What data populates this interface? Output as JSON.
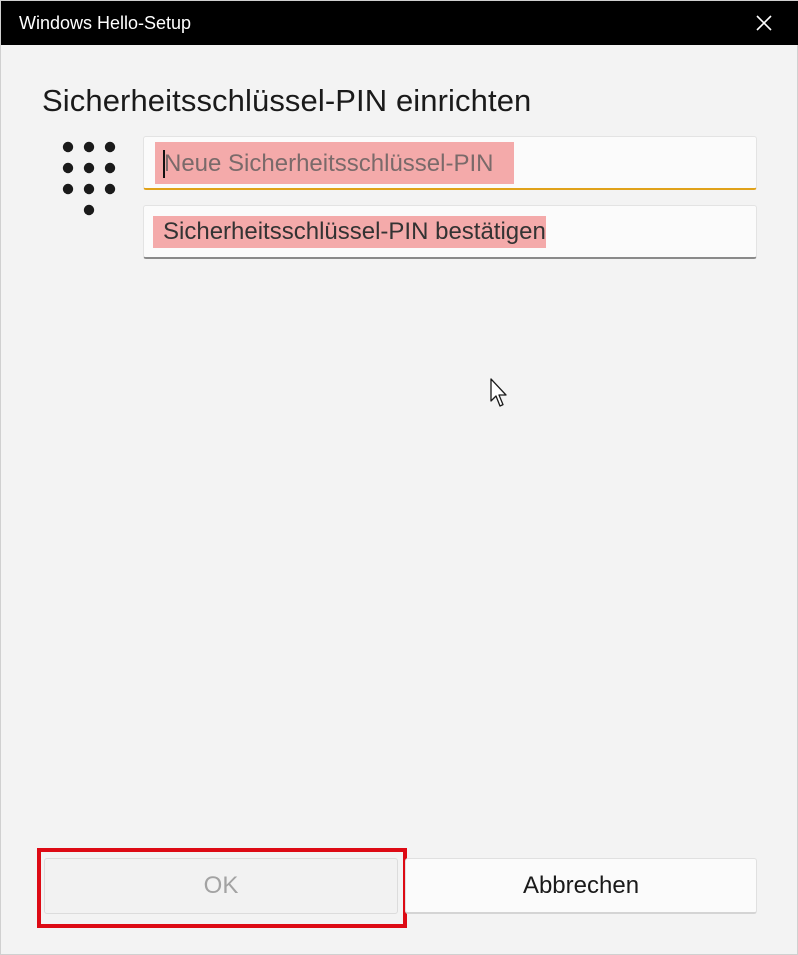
{
  "window": {
    "title": "Windows Hello-Setup",
    "close_icon": "close-icon"
  },
  "main": {
    "heading": "Sicherheitsschlüssel-PIN einrichten",
    "keypad_icon": "keypad-icon",
    "new_pin": {
      "placeholder": "Neue Sicherheitsschlüssel-PIN",
      "value": ""
    },
    "confirm_pin": {
      "placeholder": "Sicherheitsschlüssel-PIN bestätigen",
      "value": ""
    }
  },
  "buttons": {
    "ok_label": "OK",
    "cancel_label": "Abbrechen"
  },
  "colors": {
    "title_bar": "#000000",
    "focus_underline": "#e0a21a",
    "field_highlight": "#f4aaaa",
    "annotation_box": "#dd0a14"
  }
}
